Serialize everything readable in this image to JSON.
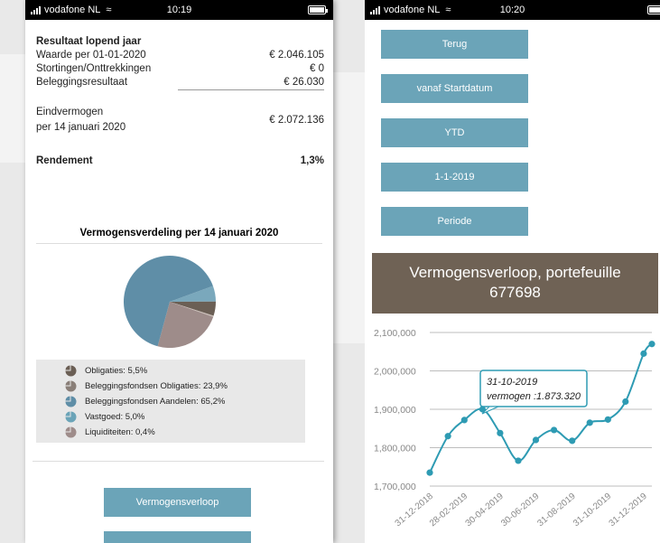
{
  "left": {
    "status": {
      "carrier": "vodafone NL",
      "time": "10:19"
    },
    "result": {
      "title": "Resultaat lopend jaar",
      "rows": [
        {
          "label": "Waarde per 01-01-2020",
          "value": "€ 2.046.105"
        },
        {
          "label": "Stortingen/Onttrekkingen",
          "value": "€ 0"
        },
        {
          "label": "Beleggingsresultaat",
          "value": "€ 26.030"
        }
      ],
      "eind_label_1": "Eindvermogen",
      "eind_label_2": "per 14 januari 2020",
      "eind_value": "€ 2.072.136",
      "rendement_label": "Rendement",
      "rendement_value": "1,3%"
    },
    "distribution": {
      "title": "Vermogensverdeling per 14 januari 2020",
      "slices": [
        {
          "name": "Obligaties",
          "label": "Obligaties: 5,5%",
          "pct": 5.5,
          "color": "#7aa8bc"
        },
        {
          "name": "Beleggingsfondsen Obligaties",
          "label": "Beleggingsfondsen Obligaties: 23,9%",
          "pct": 23.9,
          "color": "#9e8c8a"
        },
        {
          "name": "Beleggingsfondsen Aandelen",
          "label": "Beleggingsfondsen Aandelen: 65,2%",
          "pct": 65.2,
          "color": "#5f8ea7"
        },
        {
          "name": "Vastgoed",
          "label": "Vastgoed: 5,0%",
          "pct": 5.0,
          "color": "#6b5f55"
        },
        {
          "name": "Liquiditeiten",
          "label": "Liquiditeiten: 0,4%",
          "pct": 0.4,
          "color": "#c9bdb6"
        }
      ],
      "legend_icon_colors": [
        "#6b5f55",
        "#8a7f78",
        "#5f8ea7",
        "#6ba4b8",
        "#9e8c8a"
      ]
    },
    "buttons": {
      "vermogensverloop": "Vermogensverloop"
    }
  },
  "right": {
    "status": {
      "carrier": "vodafone NL",
      "time": "10:20"
    },
    "buttons": {
      "terug": "Terug",
      "vanaf_startdatum": "vanaf Startdatum",
      "ytd": "YTD",
      "date_1_1_2019": "1-1-2019",
      "periode": "Periode"
    },
    "chart_header_line1": "Vermogensverloop, portefeuille",
    "chart_header_line2": "677698",
    "tooltip": {
      "date": "31-10-2019",
      "value": "vermogen :1.873.320"
    }
  },
  "chart_data": {
    "type": "line",
    "title": "Vermogensverloop, portefeuille 677698",
    "ylim": [
      1700000,
      2100000
    ],
    "y_ticks": [
      "1,700,000",
      "1,800,000",
      "1,900,000",
      "2,000,000",
      "2,100,000"
    ],
    "x_tick_labels": [
      "31-12-2018",
      "28-02-2019",
      "30-04-2019",
      "30-06-2019",
      "31-08-2019",
      "31-10-2019",
      "31-12-2019"
    ],
    "x_dates": [
      "2018-12-31",
      "2019-01-31",
      "2019-02-28",
      "2019-03-31",
      "2019-04-30",
      "2019-05-31",
      "2019-06-30",
      "2019-07-31",
      "2019-08-31",
      "2019-09-30",
      "2019-10-31",
      "2019-11-30",
      "2019-12-31",
      "2020-01-14"
    ],
    "values": [
      1735000,
      1830000,
      1872000,
      1900000,
      1838000,
      1766000,
      1820000,
      1846000,
      1818000,
      1865000,
      1873320,
      1920000,
      2045000,
      2070000
    ],
    "grid": true,
    "line_color": "#2e9bb3"
  }
}
